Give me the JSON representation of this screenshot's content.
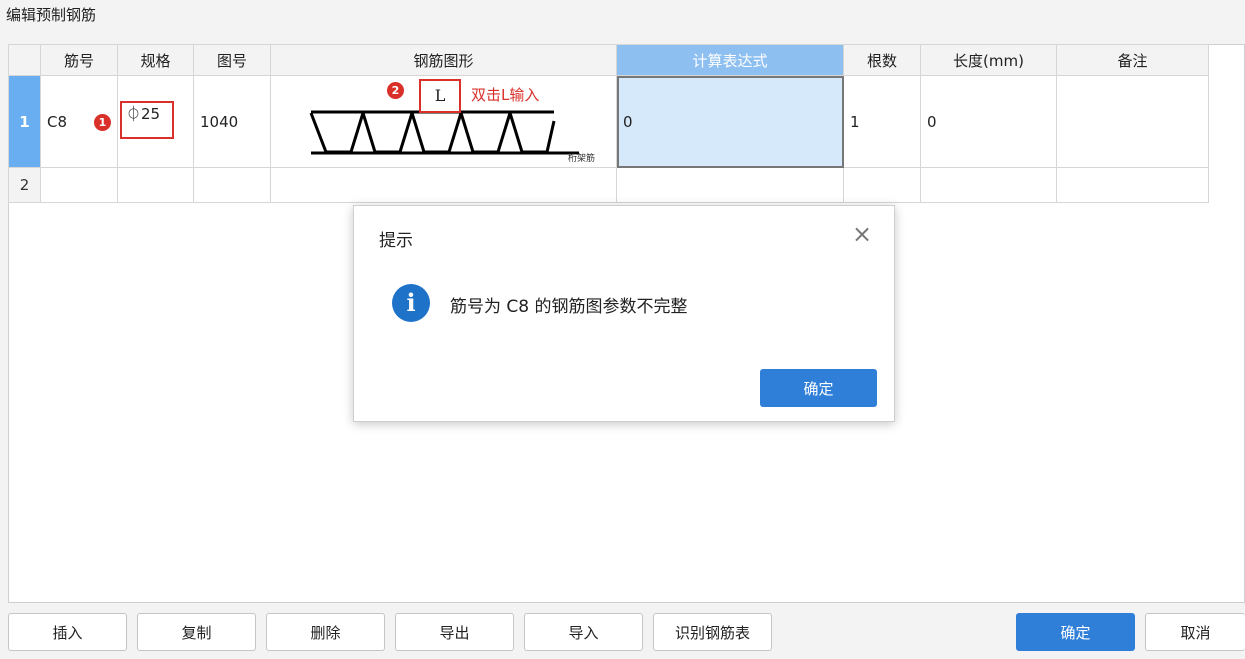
{
  "window": {
    "title": "编辑预制钢筋"
  },
  "table": {
    "headers": [
      "筋号",
      "规格",
      "图号",
      "钢筋图形",
      "计算表达式",
      "根数",
      "长度(mm)",
      "备注"
    ],
    "rows": [
      {
        "num": "1",
        "bar_no": "C8",
        "spec": "⏀25",
        "figure_no": "1040",
        "expression": "0",
        "count": "1",
        "length": "0",
        "note": ""
      },
      {
        "num": "2",
        "bar_no": "",
        "spec": "",
        "figure_no": "",
        "expression": "",
        "count": "",
        "length": "",
        "note": ""
      }
    ]
  },
  "annotations": {
    "badge1": "1",
    "badge2": "2",
    "l_box": "L",
    "hint": "双击L输入",
    "shape_label": "桁架筋"
  },
  "dialog": {
    "title": "提示",
    "message": "筋号为 C8 的钢筋图参数不完整",
    "ok": "确定",
    "close": "×",
    "info": "i"
  },
  "toolbar": {
    "insert": "插入",
    "copy": "复制",
    "delete": "删除",
    "export": "导出",
    "import": "导入",
    "recognize": "识别钢筋表",
    "confirm": "确定",
    "cancel": "取消"
  },
  "colors": {
    "accent": "#2f7fd9",
    "selected_header": "#8dbff0",
    "annotation_red": "#d9302a",
    "info_icon": "#1e73c9"
  }
}
